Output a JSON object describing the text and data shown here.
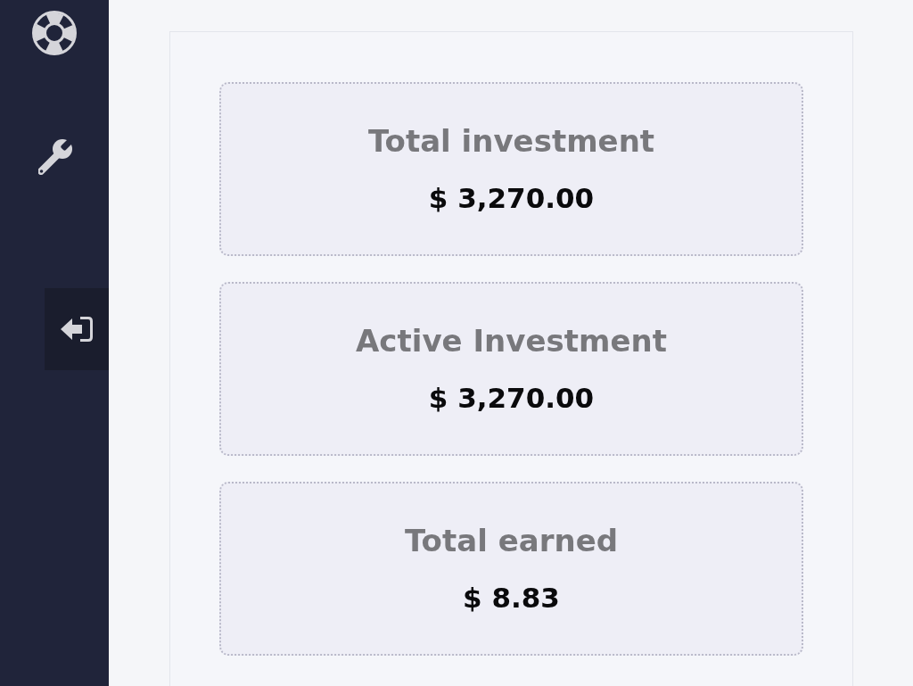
{
  "sidebar": {
    "items": [
      {
        "kind": "help",
        "selected": false
      },
      {
        "kind": "settings",
        "selected": false
      },
      {
        "kind": "logout",
        "selected": true
      }
    ]
  },
  "stats": [
    {
      "label": "Total investment",
      "value": "$ 3,270.00"
    },
    {
      "label": "Active Investment",
      "value": "$ 3,270.00"
    },
    {
      "label": "Total earned",
      "value": "$ 8.83"
    }
  ]
}
